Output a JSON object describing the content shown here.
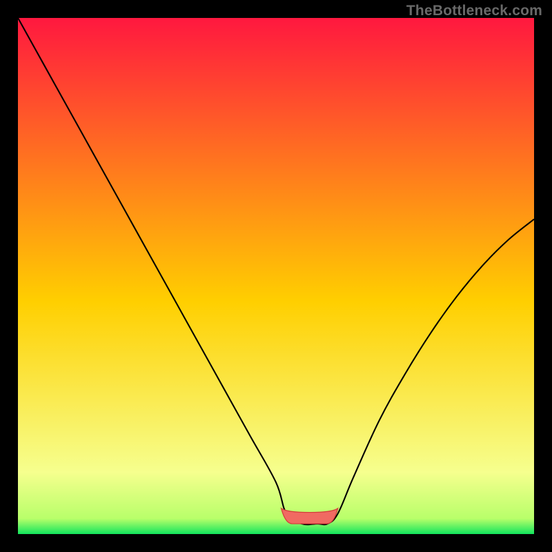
{
  "watermark": "TheBottleneck.com",
  "colors": {
    "top_gradient": "#ff183f",
    "mid_gradient": "#ffcf00",
    "bottom_gradient": "#11e55d",
    "curve": "#000000",
    "optimal_fill": "#f06a62",
    "optimal_stroke": "#d23c3a"
  },
  "chart_data": {
    "type": "line",
    "title": "",
    "xlabel": "",
    "ylabel": "",
    "xlim": [
      0,
      100
    ],
    "ylim": [
      0,
      100
    ],
    "grid": false,
    "x": [
      0,
      5,
      10,
      15,
      20,
      25,
      30,
      35,
      40,
      45,
      50,
      52,
      55,
      58,
      60,
      62,
      65,
      70,
      75,
      80,
      85,
      90,
      95,
      100
    ],
    "values": [
      100,
      91,
      82,
      73,
      64,
      55,
      46,
      37,
      28,
      19,
      10,
      4,
      2,
      2,
      2,
      4,
      11,
      22,
      31,
      39,
      46,
      52,
      57,
      61
    ],
    "optimal_zone": {
      "x_start": 51,
      "x_end": 62,
      "y": 2,
      "height": 2.2
    }
  }
}
